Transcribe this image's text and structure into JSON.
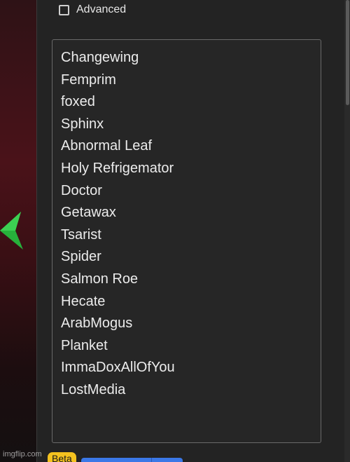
{
  "advanced": {
    "label": "Advanced",
    "checked": false
  },
  "list": {
    "items": [
      "Changewing",
      "Femprim",
      "foxed",
      "Sphinx",
      "Abnormal Leaf",
      "Holy Refrigemator",
      "Doctor",
      "Getawax",
      "Tsarist",
      "Spider",
      "Salmon Roe",
      "Hecate",
      "ArabMogus",
      "Planket",
      "ImmaDoxAllOfYou",
      "LostMedia"
    ]
  },
  "footer": {
    "beta_label": "Beta"
  },
  "watermark": "imgflip.com",
  "colors": {
    "arrow": "#27b03b",
    "beta": "#f4c21f",
    "button": "#3b78e7"
  }
}
